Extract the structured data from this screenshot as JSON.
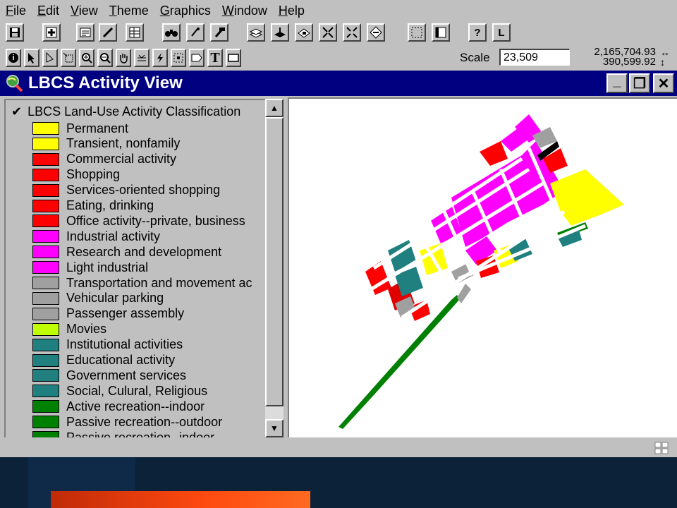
{
  "menu": [
    {
      "label": "File",
      "underline": "F",
      "rest": "ile"
    },
    {
      "label": "Edit",
      "underline": "E",
      "rest": "dit"
    },
    {
      "label": "View",
      "underline": "V",
      "rest": "iew"
    },
    {
      "label": "Theme",
      "underline": "T",
      "rest": "heme"
    },
    {
      "label": "Graphics",
      "underline": "G",
      "rest": "raphics"
    },
    {
      "label": "Window",
      "underline": "W",
      "rest": "indow"
    },
    {
      "label": "Help",
      "underline": "H",
      "rest": "elp"
    }
  ],
  "toolbar": {
    "help_label": "?",
    "l_label": "L",
    "info_label": "i",
    "text_tool_label": "T"
  },
  "scale": {
    "label": "Scale",
    "value": "23,509"
  },
  "coords": {
    "x": "2,165,704.93",
    "y": "390,599.92"
  },
  "window": {
    "title": "LBCS Activity View",
    "minimize": "_",
    "restore": "❐",
    "close": "✕"
  },
  "legend": {
    "theme_name": "LBCS Land-Use Activity Classification",
    "checked": "✔",
    "items": [
      {
        "label": "Permanent",
        "color": "#ffff00"
      },
      {
        "label": "Transient, nonfamily",
        "color": "#ffff00"
      },
      {
        "label": "Commercial activity",
        "color": "#ff0000"
      },
      {
        "label": "Shopping",
        "color": "#ff0000"
      },
      {
        "label": "Services-oriented shopping",
        "color": "#ff0000"
      },
      {
        "label": "Eating, drinking",
        "color": "#ff0000"
      },
      {
        "label": "Office activity--private, business",
        "color": "#ff0000"
      },
      {
        "label": "Industrial activity",
        "color": "#ff00ff"
      },
      {
        "label": "Research and development",
        "color": "#ff00ff"
      },
      {
        "label": "Light industrial",
        "color": "#ff00ff"
      },
      {
        "label": "Transportation and movement ac",
        "color": "#a0a0a0"
      },
      {
        "label": "Vehicular parking",
        "color": "#a0a0a0"
      },
      {
        "label": "Passenger assembly",
        "color": "#a0a0a0"
      },
      {
        "label": "Movies",
        "color": "#c0ff00"
      },
      {
        "label": "Institutional activities",
        "color": "#208080"
      },
      {
        "label": "Educational activity",
        "color": "#208080"
      },
      {
        "label": "Government services",
        "color": "#208080"
      },
      {
        "label": "Social, Culural, Religious",
        "color": "#208080"
      },
      {
        "label": "Active recreation--indoor",
        "color": "#008000"
      },
      {
        "label": "Passive recreation--outdoor",
        "color": "#008000"
      },
      {
        "label": "Passive recreation--indoor",
        "color": "#008000"
      }
    ]
  },
  "scroll": {
    "up": "▲",
    "down": "▼"
  },
  "colors": {
    "title_bg": "#000080",
    "chrome": "#c0c0c0",
    "map_bg": "#ffffff"
  }
}
